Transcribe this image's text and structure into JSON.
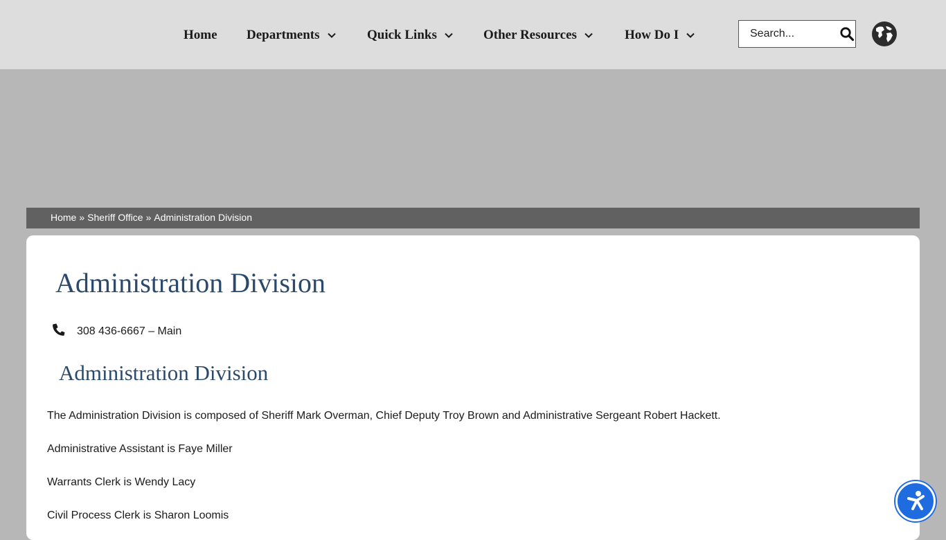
{
  "nav": {
    "items": [
      {
        "label": "Home",
        "has_dropdown": false
      },
      {
        "label": "Departments",
        "has_dropdown": true
      },
      {
        "label": "Quick Links",
        "has_dropdown": true
      },
      {
        "label": "Other Resources",
        "has_dropdown": true
      },
      {
        "label": "How Do I",
        "has_dropdown": true
      }
    ],
    "dropdown_icon": "chevron-down-icon"
  },
  "search": {
    "placeholder": "Search...",
    "icon": "search-icon"
  },
  "language_icon": "globe-icon",
  "breadcrumb": {
    "items": [
      "Home",
      "Sheriff Office"
    ],
    "separator": "»",
    "current": "Administration Division"
  },
  "main": {
    "title": "Administration Division",
    "phone": {
      "icon": "phone-icon",
      "text": "308 436-6667 – Main"
    },
    "section_title": "Administration Division",
    "paragraphs": [
      "The Administration Division is composed of Sheriff Mark Overman, Chief Deputy Troy Brown and Administrative Sergeant Robert Hackett.",
      "Administrative Assistant is Faye Miller",
      "Warrants Clerk is Wendy Lacy",
      "Civil Process Clerk is Sharon Loomis"
    ]
  },
  "accessibility_icon": "accessibility-icon",
  "colors": {
    "header_bg": "#dddddd",
    "page_bg": "#b7b7b7",
    "breadcrumb_bg": "#616161",
    "heading": "#2b4a6b",
    "accessibility": "#1e6ce0"
  }
}
